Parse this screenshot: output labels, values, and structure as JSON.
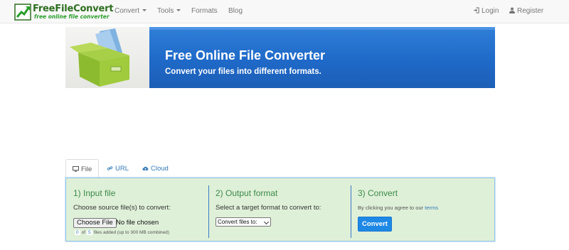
{
  "brand": {
    "name": "FreeFileConvert",
    "tagline": "free online file converter"
  },
  "nav": {
    "items": [
      {
        "label": "Convert",
        "dropdown": true
      },
      {
        "label": "Tools",
        "dropdown": true
      },
      {
        "label": "Formats",
        "dropdown": false
      },
      {
        "label": "Blog",
        "dropdown": false
      }
    ],
    "login_label": "Login",
    "register_label": "Register",
    "login_icon": "sign-in-icon",
    "register_icon": "user-icon"
  },
  "banner": {
    "title": "Free Online File Converter",
    "subtitle": "Convert your files into different formats."
  },
  "tabs": [
    {
      "label": "File",
      "icon": "monitor-icon",
      "active": true
    },
    {
      "label": "URL",
      "icon": "link-icon",
      "active": false
    },
    {
      "label": "Cloud",
      "icon": "cloud-icon",
      "active": false
    }
  ],
  "steps": {
    "input": {
      "title": "1) Input file",
      "instruction": "Choose source file(s) to convert:",
      "choose_button": "Choose File",
      "file_status": "No file chosen",
      "count_current": "0",
      "count_of": "of",
      "count_max": "5",
      "count_suffix": "files added (up to 300 MB combined)"
    },
    "output": {
      "title": "2) Output format",
      "instruction": "Select a target format to convert to:",
      "select_value": "Convert files to:"
    },
    "convert": {
      "title": "3) Convert",
      "note_prefix": "By clicking you agree to our",
      "terms_link": "terms",
      "button_label": "Convert"
    }
  },
  "colors": {
    "navbar_bg": "#f8f8f8",
    "banner_blue": "#1f69c8",
    "panel_bg": "#dff0d8",
    "step_title": "#3c8a4a",
    "link": "#337ab7",
    "convert_button": "#1e88e5"
  }
}
